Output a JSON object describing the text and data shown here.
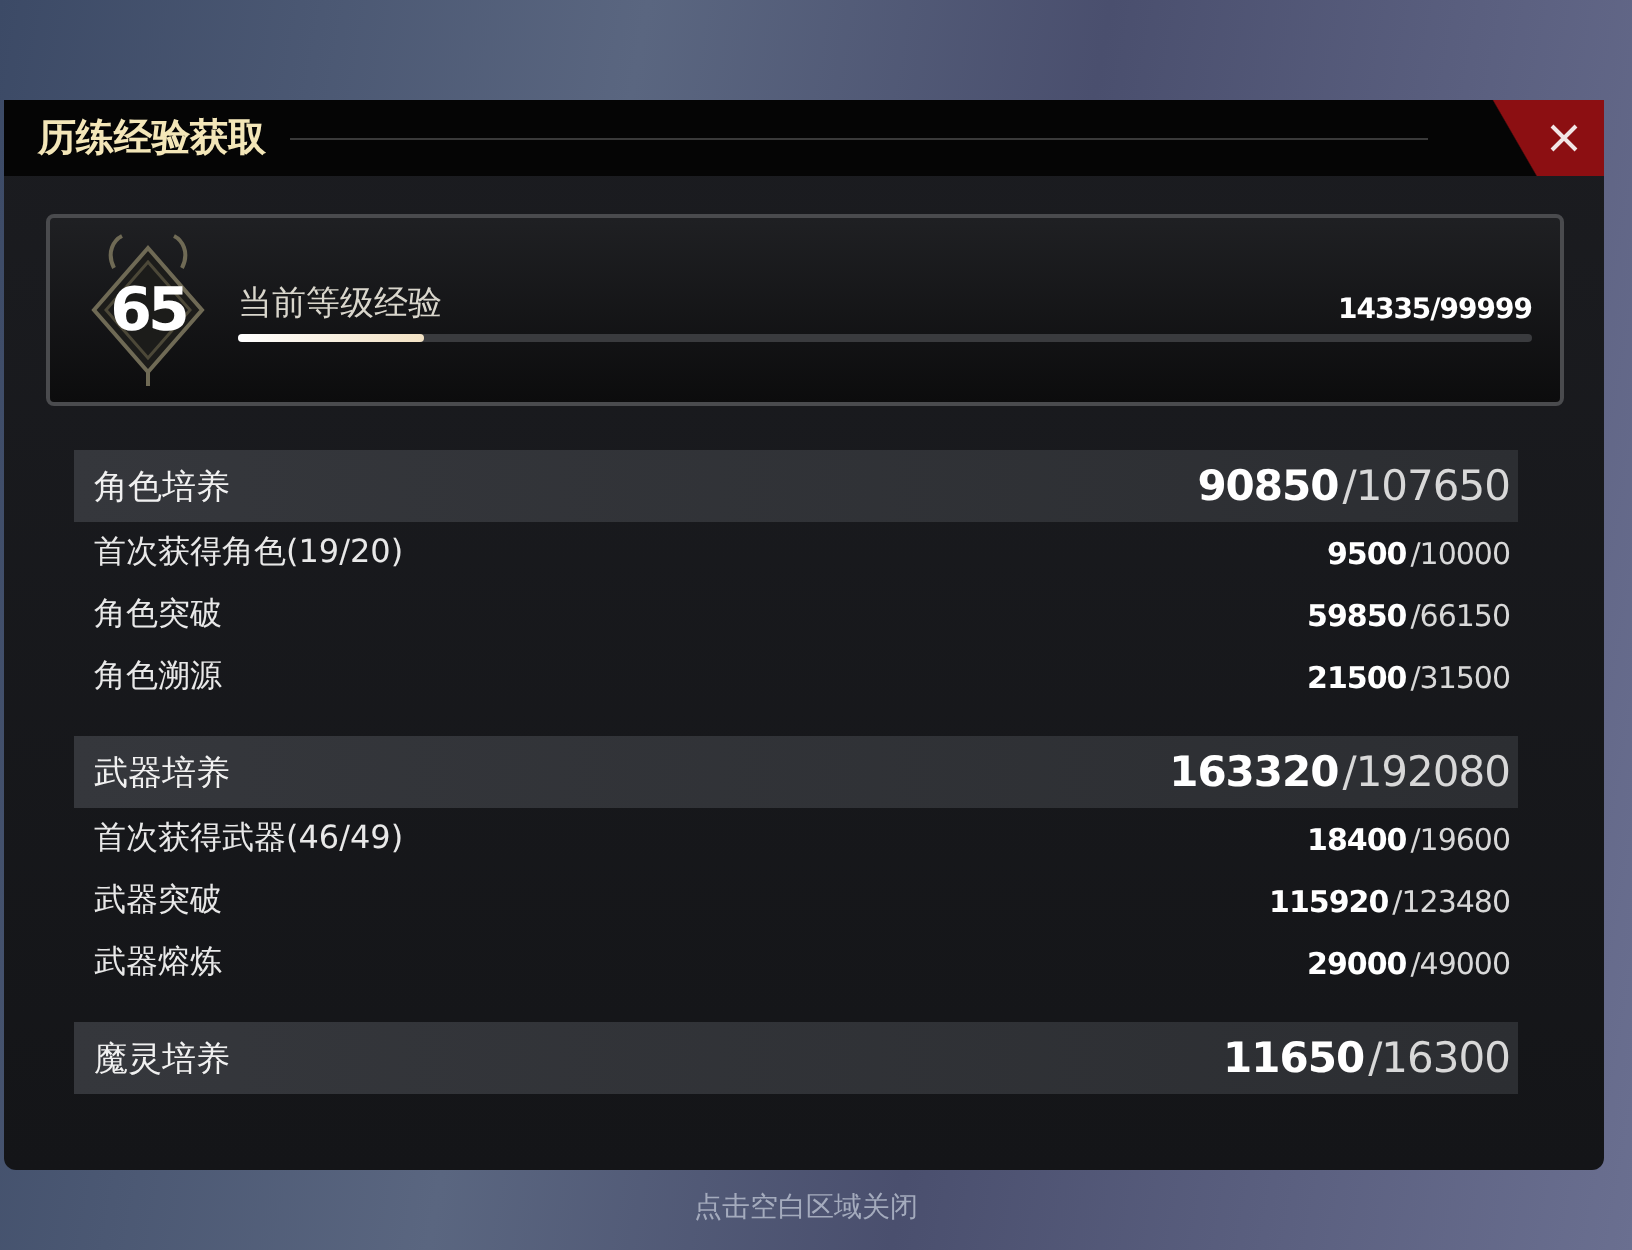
{
  "dialog": {
    "title": "历练经验获取"
  },
  "level_card": {
    "level": "65",
    "label": "当前等级经验",
    "progress": {
      "level": 0.144
    },
    "reading": "14335/99999"
  },
  "sections": [
    {
      "title": "角色培养",
      "value": "90850",
      "total": "/107650",
      "rows": [
        {
          "label": "首次获得角色(19/20)",
          "value": "9500",
          "total": "/10000"
        },
        {
          "label": "角色突破",
          "value": "59850",
          "total": "/66150"
        },
        {
          "label": "角色溯源",
          "value": "21500",
          "total": "/31500"
        }
      ]
    },
    {
      "title": "武器培养",
      "value": "163320",
      "total": "/192080",
      "rows": [
        {
          "label": "首次获得武器(46/49)",
          "value": "18400",
          "total": "/19600"
        },
        {
          "label": "武器突破",
          "value": "115920",
          "total": "/123480"
        },
        {
          "label": "武器熔炼",
          "value": "29000",
          "total": "/49000"
        }
      ]
    },
    {
      "title": "魔灵培养",
      "value": "11650",
      "total": "/16300"
    }
  ],
  "hint": "点击空白区域关闭"
}
